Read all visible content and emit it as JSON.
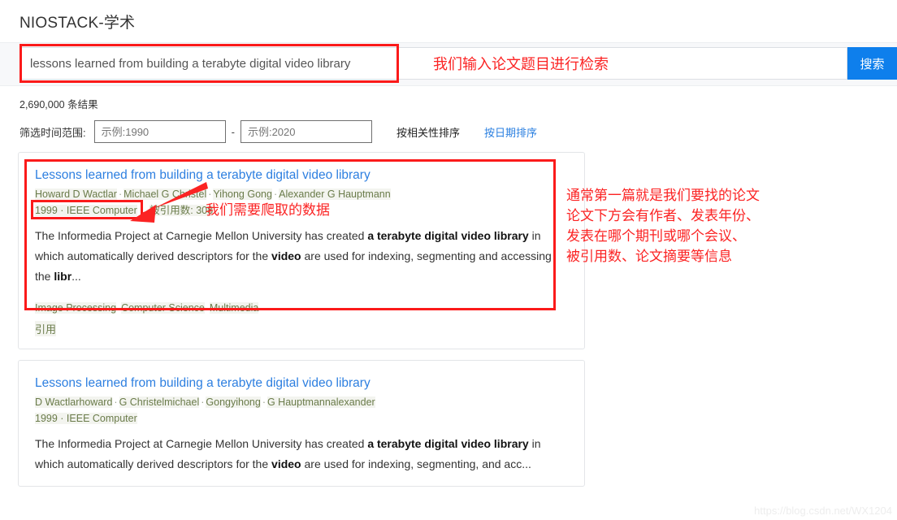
{
  "header": {
    "site_title": "NIOSTACK-学术"
  },
  "search": {
    "value": "lessons learned from building a terabyte digital video library",
    "placeholder": "",
    "button_label": "搜索",
    "annotation": "我们输入论文题目进行检索"
  },
  "meta": {
    "results_count": "2,690,000 条结果",
    "filter_label": "筛选时间范围:",
    "year_from_placeholder": "示例:1990",
    "year_from_value": "",
    "year_to_placeholder": "示例:2020",
    "year_to_value": "",
    "dash": "-",
    "sort_relevance": "按相关性排序",
    "sort_date": "按日期排序"
  },
  "results": [
    {
      "title": "Lessons learned from building a terabyte digital video library",
      "authors": [
        "Howard D Wactlar",
        "Michael G Christel",
        "Yihong Gong",
        "Alexander G Hauptmann"
      ],
      "year": "1999",
      "venue": "IEEE Computer",
      "citations_label": "被引用数:",
      "citations_value": "308",
      "abstract_parts": [
        {
          "text": "The Informedia Project at Carnegie Mellon University has created ",
          "bold": false
        },
        {
          "text": "a terabyte digital video library",
          "bold": true
        },
        {
          "text": " in which automatically derived descriptors for the ",
          "bold": false
        },
        {
          "text": "video",
          "bold": true
        },
        {
          "text": " are used for indexing, segmenting and accessing the ",
          "bold": false
        },
        {
          "text": "libr",
          "bold": true
        },
        {
          "text": "...",
          "bold": false
        }
      ],
      "tags": [
        "Image Processing",
        "Computer Science",
        "Multimedia"
      ],
      "cite_label": "引用"
    },
    {
      "title": "Lessons learned from building a terabyte digital video library",
      "authors": [
        "D Wactlarhoward",
        "G Christelmichael",
        "Gongyihong",
        "G Hauptmannalexander"
      ],
      "year": "1999",
      "venue": "IEEE Computer",
      "citations_label": "",
      "citations_value": "",
      "abstract_parts": [
        {
          "text": "The Informedia Project at Carnegie Mellon University has created ",
          "bold": false
        },
        {
          "text": "a terabyte digital video",
          "bold": true
        },
        {
          "text": " ",
          "bold": false
        },
        {
          "text": "library",
          "bold": true
        },
        {
          "text": " in which automatically derived descriptors for the ",
          "bold": false
        },
        {
          "text": "video",
          "bold": true
        },
        {
          "text": " are used for indexing, segmenting, and acc...",
          "bold": false
        }
      ],
      "tags": [],
      "cite_label": ""
    }
  ],
  "annotations": {
    "need_data": "我们需要爬取的数据",
    "block_lines": [
      "通常第一篇就是我们要找的论文",
      "论文下方会有作者、发表年份、",
      "发表在哪个期刊或哪个会议、",
      "被引用数、论文摘要等信息"
    ]
  },
  "watermark": "https://blog.csdn.net/WX1204",
  "colors": {
    "accent_blue": "#0e7fec",
    "link_blue": "#2d7fe0",
    "annotation_red": "#fb2323",
    "meta_green": "#6a7b4a"
  }
}
